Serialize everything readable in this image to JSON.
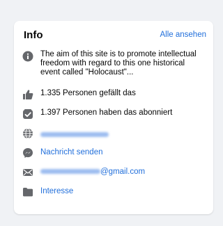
{
  "card": {
    "title": "Info",
    "see_all_label": "Alle ansehen"
  },
  "about": {
    "description": "The aim of this site is to promote intellectual freedom with regard to this one historical event called \"Holocaust\"...",
    "likes_text": "1.335 Personen gefällt das",
    "followers_text": "1.397 Personen haben das abonniert",
    "website_text": "http://codoh.com/",
    "message_label": "Nachricht senden",
    "email_user_text": "codohcodonach",
    "email_domain_text": "@gmail.com",
    "category_label": "Interesse"
  },
  "colors": {
    "icon_gray": "#65676b",
    "link_blue": "#216fdb",
    "background": "#f0f2f5"
  },
  "icons": [
    "info-icon",
    "thumbs-up-icon",
    "follow-check-icon",
    "globe-icon",
    "messenger-icon",
    "envelope-icon",
    "category-icon"
  ]
}
